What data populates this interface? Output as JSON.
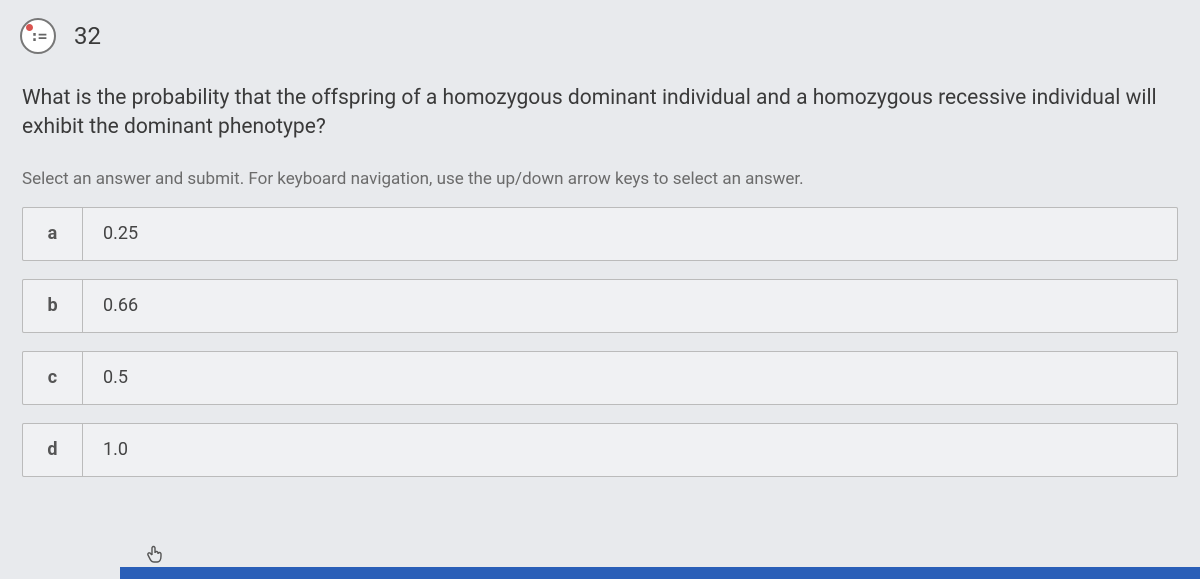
{
  "header": {
    "question_number": "32",
    "icon_glyph": ":="
  },
  "question": {
    "text": "What is the probability that the offspring of a homozygous dominant individual and a homozygous recessive individual will exhibit the dominant phenotype?"
  },
  "instruction": "Select an answer and submit. For keyboard navigation, use the up/down arrow keys to select an answer.",
  "options": [
    {
      "letter": "a",
      "value": "0.25"
    },
    {
      "letter": "b",
      "value": "0.66"
    },
    {
      "letter": "c",
      "value": "0.5"
    },
    {
      "letter": "d",
      "value": "1.0"
    }
  ]
}
